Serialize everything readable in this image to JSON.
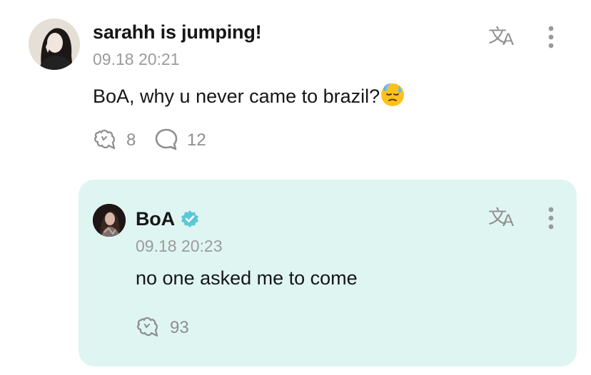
{
  "post": {
    "username": "sarahh is jumping!",
    "timestamp": "09.18 20:21",
    "content": "BoA, why u never came to brazil?",
    "emoji": "😓",
    "reaction_count": "8",
    "comment_count": "12",
    "icons": {
      "reaction": "bubble-reaction-icon",
      "comment": "comment-icon",
      "translate": "translate-icon",
      "more": "more-options-icon"
    }
  },
  "reply": {
    "username": "BoA",
    "verified": true,
    "timestamp": "09.18 20:23",
    "content": "no one asked me to come",
    "reaction_count": "93",
    "background_color": "#dff5f2",
    "verified_color": "#5cc7d6"
  }
}
